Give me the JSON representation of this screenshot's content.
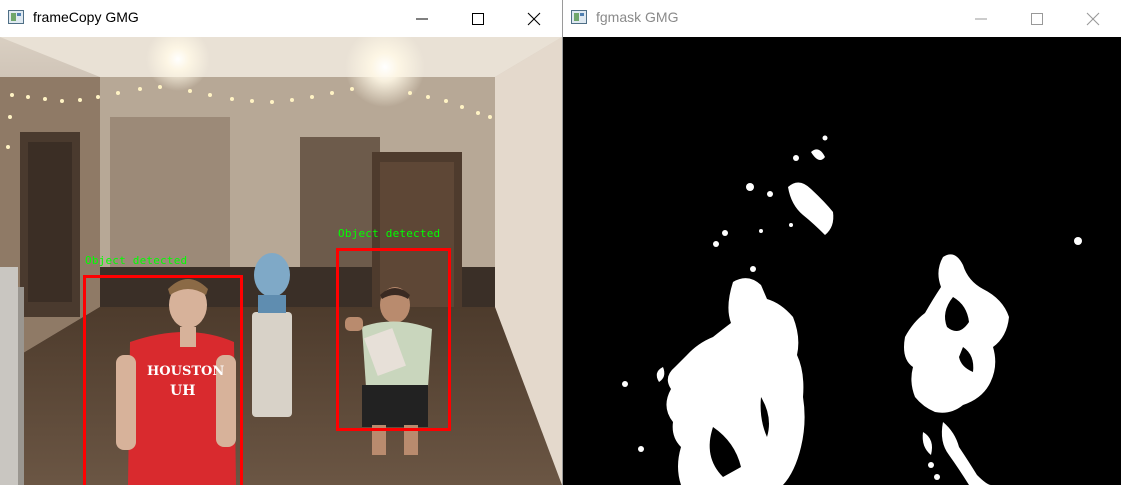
{
  "windows": [
    {
      "title": "frameCopy GMG",
      "detections": [
        {
          "label": "Object detected"
        },
        {
          "label": "Object detected"
        }
      ],
      "shirt_text": "HOUSTON",
      "shirt_logo": "UH"
    },
    {
      "title": "fgmask GMG"
    }
  ],
  "controls": {
    "minimize": "minimize-icon",
    "maximize": "maximize-icon",
    "close": "close-icon"
  },
  "colors": {
    "box": "#ff0000",
    "label": "#00ff00",
    "mask_bg": "#000000",
    "mask_fg": "#ffffff",
    "inactive_title": "#8a8a8a"
  }
}
